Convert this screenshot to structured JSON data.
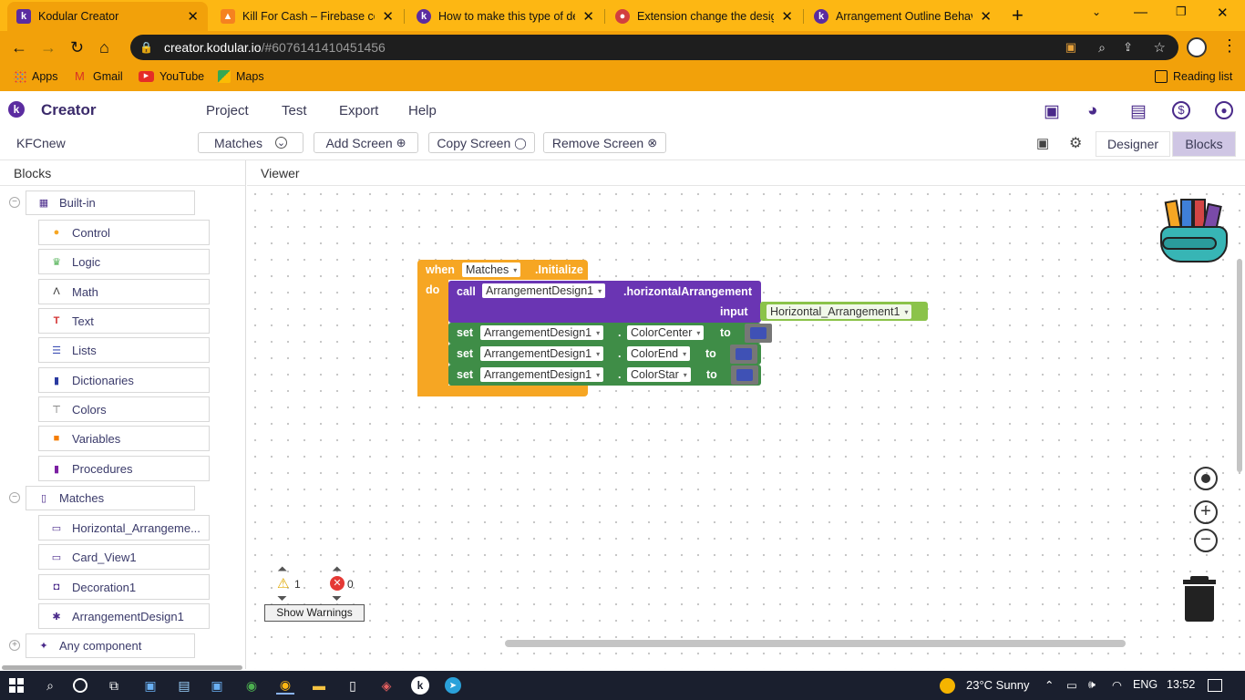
{
  "browser": {
    "tabs": [
      {
        "title": "Kodular Creator",
        "active": true
      },
      {
        "title": "Kill For Cash – Firebase console",
        "active": false
      },
      {
        "title": "How to make this type of design",
        "active": false
      },
      {
        "title": "Extension change the design",
        "active": false
      },
      {
        "title": "Arrangement Outline Behaviour",
        "active": false
      }
    ],
    "url_host": "creator.kodular.io",
    "url_path": "/#6076141410451456",
    "bookmarks": [
      "Apps",
      "Gmail",
      "YouTube",
      "Maps"
    ],
    "reading_list": "Reading list"
  },
  "app": {
    "name": "Creator",
    "menu": [
      "Project",
      "Test",
      "Export",
      "Help"
    ],
    "project": "KFCnew",
    "screen_select": "Matches",
    "add_screen": "Add Screen",
    "copy_screen": "Copy Screen",
    "remove_screen": "Remove Screen",
    "designer": "Designer",
    "blocks": "Blocks"
  },
  "sidebar": {
    "header": "Blocks",
    "builtin": "Built-in",
    "builtin_items": [
      "Control",
      "Logic",
      "Math",
      "Text",
      "Lists",
      "Dictionaries",
      "Colors",
      "Variables",
      "Procedures"
    ],
    "screen": "Matches",
    "components": [
      "Horizontal_Arrangeme...",
      "Card_View1",
      "Decoration1",
      "ArrangementDesign1"
    ],
    "any_component": "Any component"
  },
  "viewer": {
    "header": "Viewer",
    "event": {
      "when": "when",
      "component": "Matches",
      "event_name": ".Initialize",
      "do": "do"
    },
    "call": {
      "call": "call",
      "component": "ArrangementDesign1",
      "method": ".horizontalArrangement",
      "param": "input",
      "arg": "Horizontal_Arrangement1"
    },
    "sets": [
      {
        "set": "set",
        "component": "ArrangementDesign1",
        "dot": ".",
        "property": "ColorCenter",
        "to": "to"
      },
      {
        "set": "set",
        "component": "ArrangementDesign1",
        "dot": ".",
        "property": "ColorEnd",
        "to": "to"
      },
      {
        "set": "set",
        "component": "ArrangementDesign1",
        "dot": ".",
        "property": "ColorStar",
        "to": "to"
      }
    ],
    "warnings_count": "1",
    "errors_count": "0",
    "show_warnings": "Show Warnings"
  },
  "taskbar": {
    "weather": "23°C  Sunny",
    "lang": "ENG",
    "time": "13:52"
  },
  "colors": {
    "chrome_orange": "#fdb713",
    "event_block": "#f6a623",
    "call_block": "#6a35b3",
    "set_block": "#3f8d47",
    "text_block": "#8bc34a",
    "color_swatch": "#3f51b5",
    "blocks_tab": "#cfc6e4"
  }
}
